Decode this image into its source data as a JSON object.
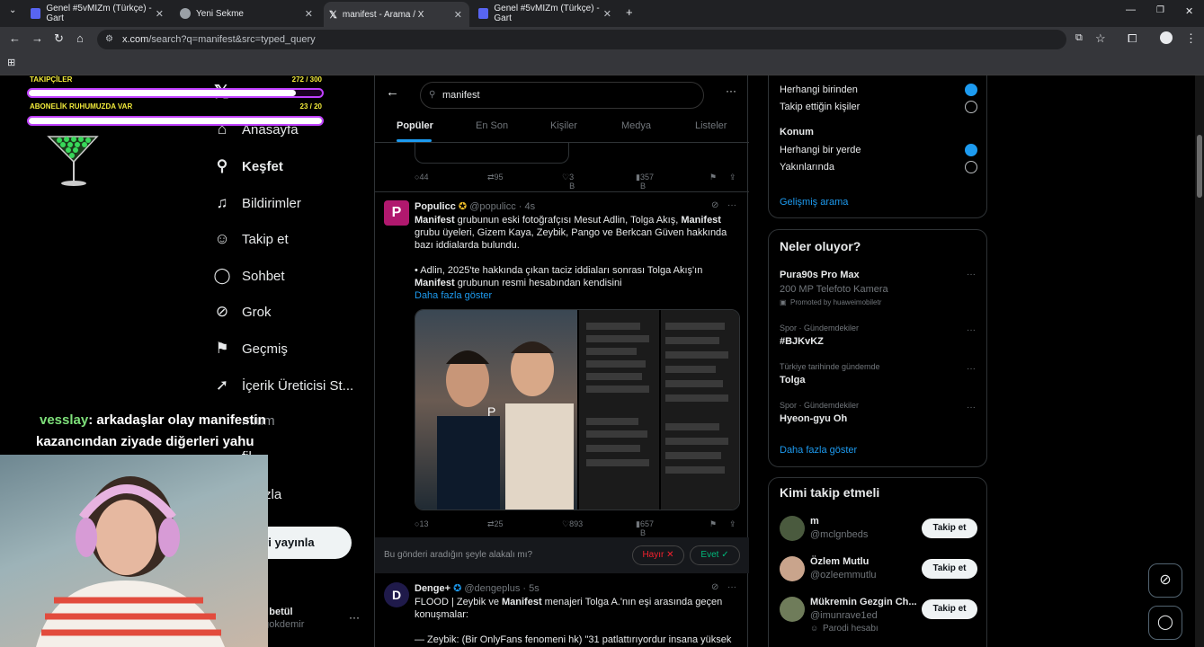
{
  "browser": {
    "tabs": [
      {
        "title": "Genel #5vMIZm (Türkçe) - Gart",
        "active": false
      },
      {
        "title": "Yeni Sekme",
        "active": false
      },
      {
        "title": "manifest - Arama / X",
        "active": true
      },
      {
        "title": "Genel #5vMIZm (Türkçe) - Gart",
        "active": false
      }
    ],
    "url_host": "x.com",
    "url_path": "/search?q=manifest&src=typed_query"
  },
  "overlay": {
    "goal1_label": "TAKIPÇİLER",
    "goal1_value": "272 / 300",
    "goal1_progress": 0.91,
    "goal2_label": "ABONELİK RUHUMUZDA VAR",
    "goal2_value": "23 / 20",
    "goal2_progress": 1.0,
    "chat_user": "vesslay",
    "chat_message": ": arkadaşlar olay manifestin kazancından ziyade diğerleri yahu"
  },
  "sidebar": {
    "items": [
      {
        "label": "Anasayfa",
        "icon": "home-icon"
      },
      {
        "label": "Keşfet",
        "icon": "search-icon"
      },
      {
        "label": "Bildirimler",
        "icon": "bell-icon"
      },
      {
        "label": "Takip et",
        "icon": "person-add-icon"
      },
      {
        "label": "Sohbet",
        "icon": "chat-icon"
      },
      {
        "label": "Grok",
        "icon": "grok-icon"
      },
      {
        "label": "Geçmiş",
        "icon": "bookmark-icon"
      },
      {
        "label": "İçerik Üreticisi St...",
        "icon": "rocket-icon"
      },
      {
        "label": "mium",
        "icon": "premium-icon"
      },
      {
        "label": "fil",
        "icon": "profile-icon"
      },
      {
        "label": "a fazla",
        "icon": "more-icon"
      }
    ],
    "post_button": "eri yayınla",
    "account_name": "eli betül",
    "account_handle": "etgokdemir"
  },
  "search": {
    "query": "manifest",
    "tabs": [
      "Popüler",
      "En Son",
      "Kişiler",
      "Medya",
      "Listeler"
    ],
    "active_tab": "Popüler"
  },
  "tweets": [
    {
      "replies": "44",
      "retweets": "95",
      "likes": "3 B",
      "views": "357 B"
    },
    {
      "author": "Populicc",
      "handle": "@populicc",
      "time": "4s",
      "text_line1_b": "Manifest",
      "text_line1": " grubunun eski fotoğrafçısı Mesut Adlin, Tolga Akış, ",
      "text_line1_b2": "Manifest",
      "text_line2": "grubu üyeleri, Gizem Kaya, Zeybik, Pango ve Berkcan Güven hakkında bazı iddialarda bulundu.",
      "text_line3": "• Adlin, 2025'te hakkında çıkan taciz iddiaları sonrası Tolga Akış'ın ",
      "text_line3_b": "Manifest",
      "text_line4": "grubunun resmi hesabından kendisini",
      "show_more": "Daha fazla göster",
      "replies": "13",
      "retweets": "25",
      "likes": "893",
      "views": "657 B"
    },
    {
      "author": "Denge+",
      "handle": "@dengeplus",
      "time": "5s",
      "text_line1": "FLOOD | Zeybik ve ",
      "text_line1_b": "Manifest",
      "text_line1b": " menajeri Tolga A.'nın eşi arasında geçen",
      "text_line2": "konuşmalar:",
      "text_line3": "— Zeybik: (Bir OnlyFans fenomeni hk) \"31 patlattırıyordur insana yüksek"
    }
  ],
  "feedback": {
    "question": "Bu gönderi aradığın şeyle alakalı mı?",
    "no": "Hayır",
    "yes": "Evet"
  },
  "filters": {
    "people_opt1": "Herhangi birinden",
    "people_opt2": "Takip ettiğin kişiler",
    "location_title": "Konum",
    "location_opt1": "Herhangi bir yerde",
    "location_opt2": "Yakınlarında",
    "advanced": "Gelişmiş arama"
  },
  "trends": {
    "title": "Neler oluyor?",
    "items": [
      {
        "context": "",
        "name": "Pura90s Pro Max",
        "sub": "200 MP Telefoto Kamera",
        "promo": "Promoted by huaweimobiletr"
      },
      {
        "context": "Spor · Gündemdekiler",
        "name": "#BJKvKZ"
      },
      {
        "context": "Türkiye tarihinde gündemde",
        "name": "Tolga"
      },
      {
        "context": "Spor · Gündemdekiler",
        "name": "Hyeon-gyu Oh"
      }
    ],
    "more": "Daha fazla göster"
  },
  "who_to_follow": {
    "title": "Kimi takip etmeli",
    "follow_label": "Takip et",
    "users": [
      {
        "name": "m",
        "handle": "@mclgnbeds"
      },
      {
        "name": "Özlem Mutlu",
        "handle": "@ozleemmutlu"
      },
      {
        "name": "Mükremin Gezgin Ch...",
        "handle": "@imunrave1ed",
        "extra": "Parodi hesabı"
      }
    ]
  },
  "colors": {
    "accent": "#1d9bf0",
    "background": "#000000",
    "border": "#2f3336",
    "overlay_purple": "#c040ff"
  }
}
